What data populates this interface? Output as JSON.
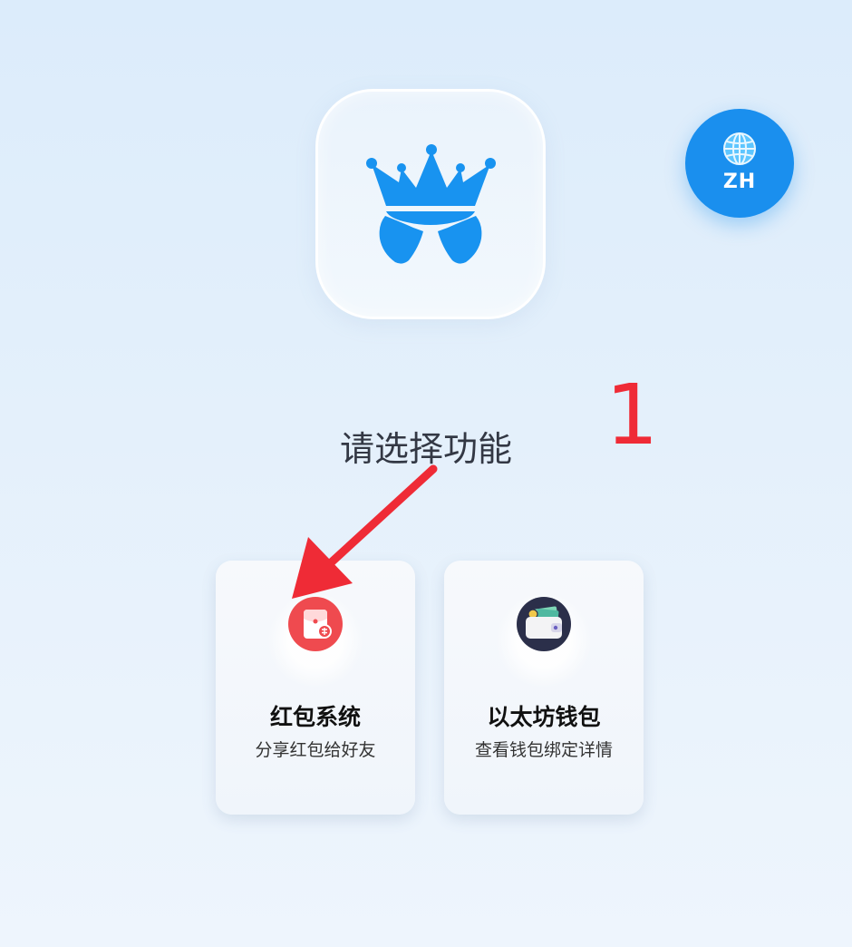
{
  "app": {
    "logo_icon": "crown-logo-icon",
    "brand_color": "#1a8fee"
  },
  "language_button": {
    "label": "ZH",
    "icon": "globe-icon"
  },
  "annotation": {
    "number": "1",
    "color": "#ef2b36"
  },
  "main": {
    "title": "请选择功能",
    "cards": [
      {
        "title": "红包系统",
        "subtitle": "分享红包给好友",
        "icon": "red-envelope-icon",
        "icon_color": "#ef4a4f"
      },
      {
        "title": "以太坊钱包",
        "subtitle": "查看钱包绑定详情",
        "icon": "wallet-icon",
        "icon_color": "#2b2f4a"
      }
    ]
  }
}
